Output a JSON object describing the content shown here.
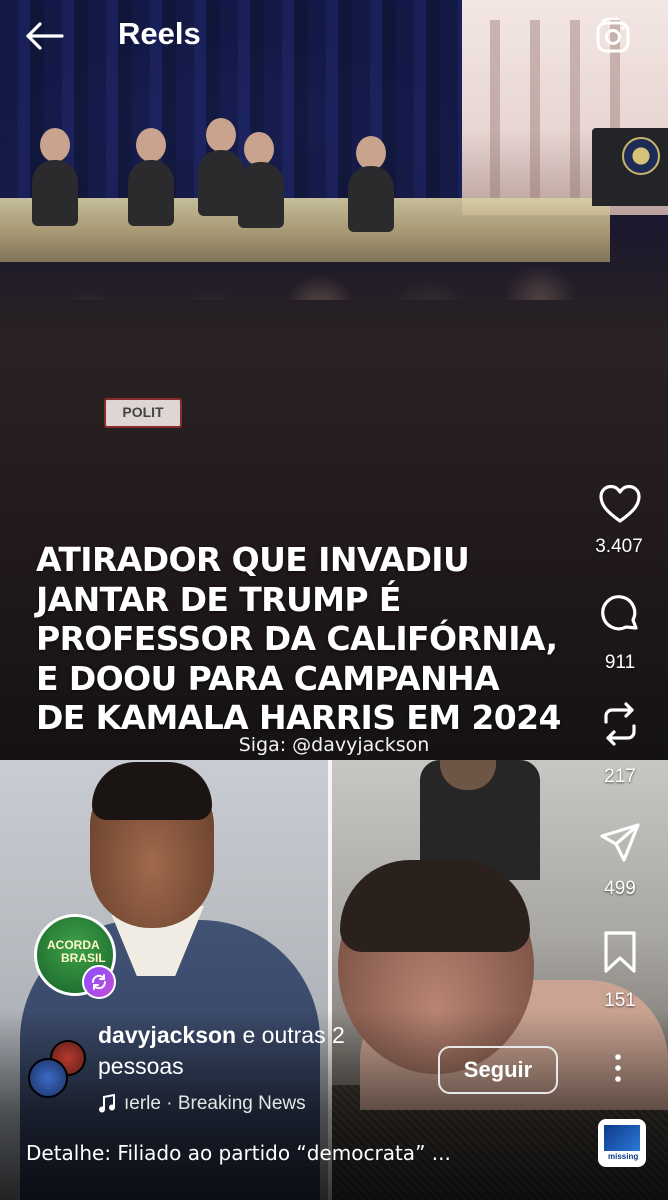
{
  "header": {
    "title": "Reels"
  },
  "video": {
    "headline_lines": [
      "ATIRADOR QUE INVADIU",
      "JANTAR DE TRUMP É",
      "PROFESSOR DA CALIFÓRNIA,",
      "E DOOU PARA CAMPANHA",
      "DE KAMALA HARRIS EM 2024"
    ],
    "follow_text": "Siga: @davyjackson",
    "sign_text": "POLIT"
  },
  "actions": {
    "likes": "3.407",
    "comments": "911",
    "remixes": "217",
    "shares": "499",
    "saves": "151"
  },
  "channel": {
    "logo_line1": "ACORDA",
    "logo_line2": "BRASIL"
  },
  "post": {
    "author": "davyjackson",
    "author_suffix": " e outras 2",
    "author_line2": "pessoas",
    "follow_button": "Seguir",
    "audio": "ıerle · Breaking News",
    "caption": "Detalhe: Filiado ao partido “democrata” ..."
  },
  "audio_thumb_label": "missing",
  "colors": {
    "overlay_text": "#ffffff",
    "background": "#000000",
    "remix_badge": "#8a4fff"
  }
}
